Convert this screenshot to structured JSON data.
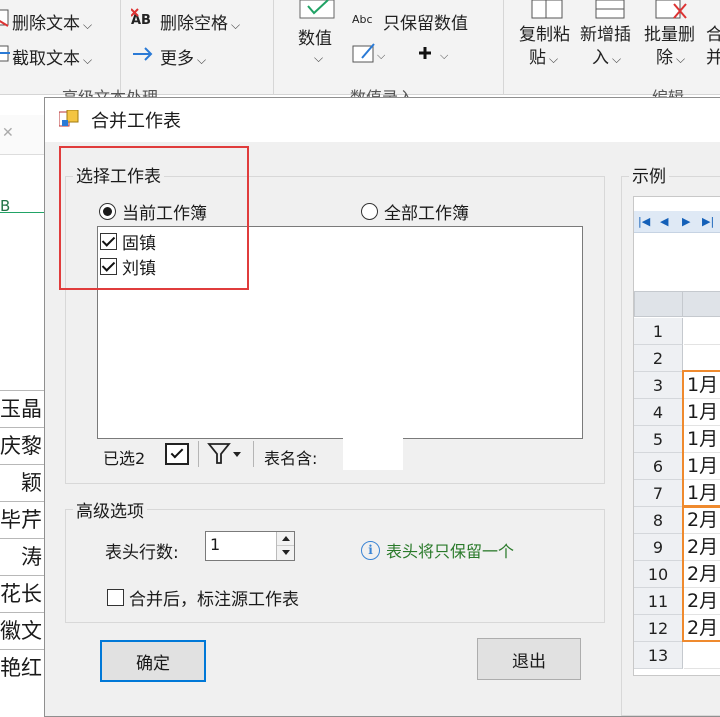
{
  "ribbon": {
    "delete_text": "删除文本",
    "delete_spaces": "删除空格",
    "truncate_text": "截取文本",
    "more": "更多",
    "group_advanced_text": "高级文本处理",
    "to_number_line1": "数值",
    "keep_numbers_only": "只保留数值",
    "group_number_entry": "数值录入",
    "copy_paste_line1": "复制粘",
    "copy_paste_line2": "贴",
    "insert_line1": "新增插",
    "insert_line2": "入",
    "batch_delete_line1": "批量删",
    "batch_delete_line2": "除",
    "group_edit": "编辑",
    "extra_line1": "合",
    "extra_line2": "并"
  },
  "sheet_left": {
    "col_label": "B",
    "names": [
      "玉晶",
      "庆黎",
      "颖",
      "毕芹",
      "涛",
      "花长",
      "徽文",
      "艳红"
    ]
  },
  "dialog": {
    "title": "合并工作表",
    "select_group": {
      "caption": "选择工作表",
      "radio_current": "当前工作簿",
      "radio_all": "全部工作簿",
      "sheets": [
        {
          "label": "固镇",
          "checked": true
        },
        {
          "label": "刘镇",
          "checked": true
        }
      ],
      "selected_count": "已选2",
      "sheet_name_contains": "表名含:",
      "sheet_name_value": ""
    },
    "advanced_group": {
      "caption": "高级选项",
      "header_rows_label": "表头行数:",
      "header_rows_value": "1",
      "info_text": "表头将只保留一个",
      "mark_source_label": "合并后，标注源工作表",
      "mark_source_checked": false
    },
    "example": {
      "caption": "示例",
      "row_numbers": [
        "1",
        "2",
        "3",
        "4",
        "5",
        "6",
        "7",
        "8",
        "9",
        "10",
        "11",
        "12",
        "13"
      ],
      "cells": [
        "",
        "",
        "1月",
        "1月",
        "1月",
        "1月",
        "1月",
        "2月",
        "2月",
        "2月",
        "2月",
        "2月",
        ""
      ]
    },
    "ok_label": "确定",
    "exit_label": "退出"
  },
  "colors": {
    "highlight_red": "#e03c3c",
    "highlight_orange": "#ef8a2e",
    "accent_blue": "#0078d7",
    "info_green": "#2a7a2a"
  }
}
